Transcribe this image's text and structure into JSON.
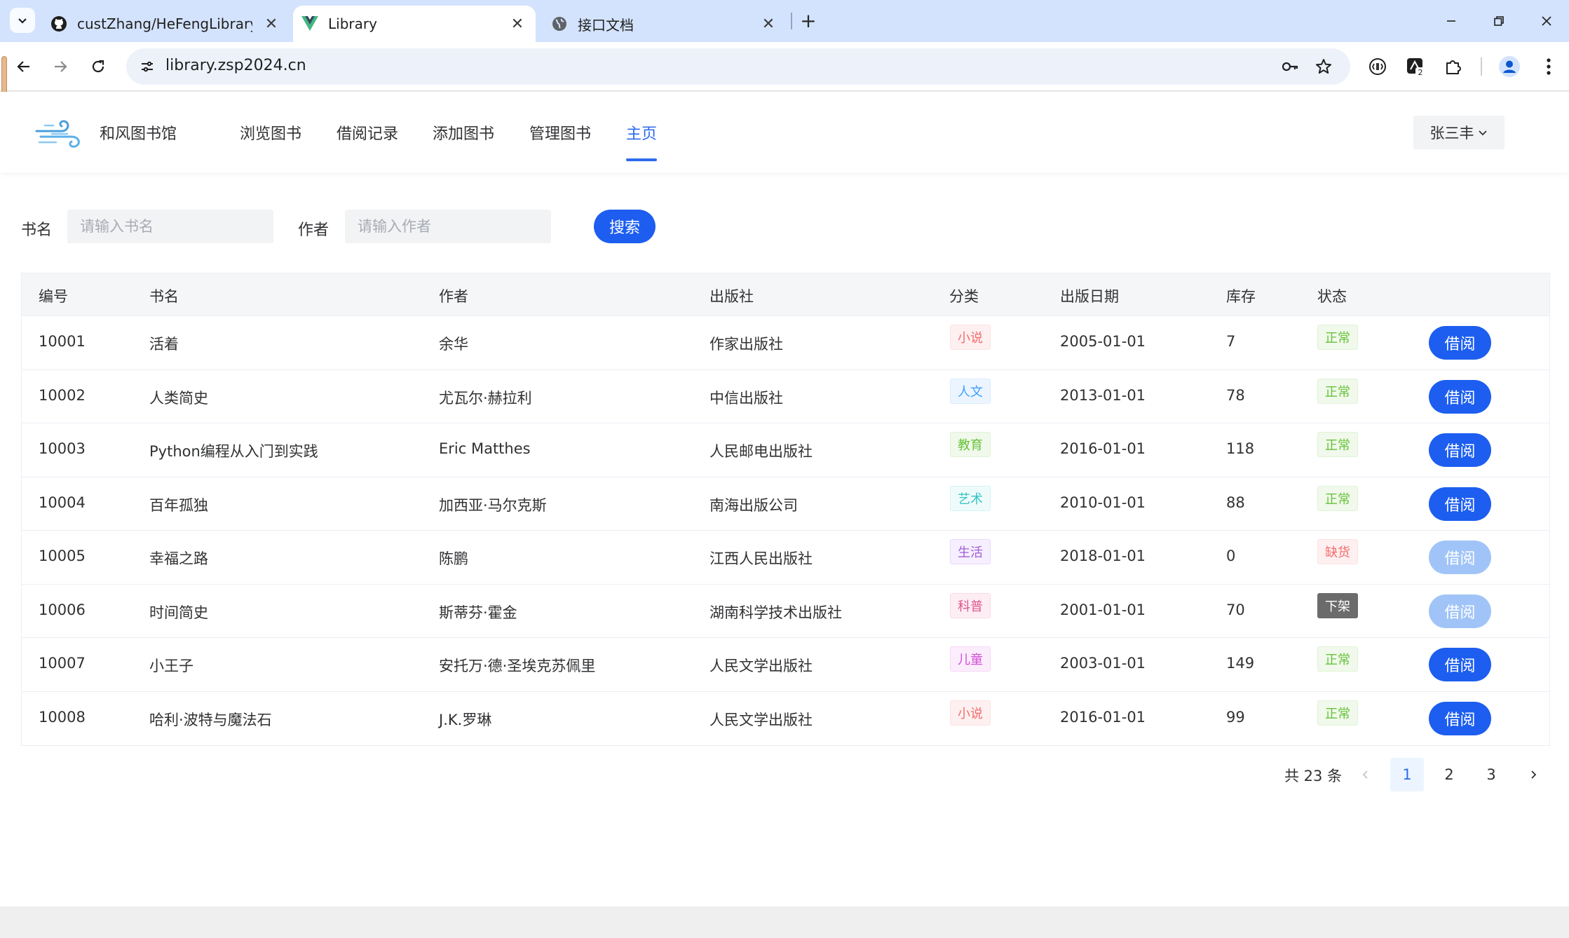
{
  "browser": {
    "tabs": [
      {
        "title": "custZhang/HeFengLibrary-fr",
        "favicon": "github-icon",
        "active": false
      },
      {
        "title": "Library",
        "favicon": "vue-icon",
        "active": true
      },
      {
        "title": "接口文档",
        "favicon": "globe-icon",
        "active": false
      }
    ],
    "url": "library.zsp2024.cn"
  },
  "app": {
    "brand": "和风图书馆",
    "nav": [
      "浏览图书",
      "借阅记录",
      "添加图书",
      "管理图书",
      "主页"
    ],
    "active_nav": "主页",
    "user": "张三丰"
  },
  "search": {
    "title_label": "书名",
    "title_placeholder": "请输入书名",
    "author_label": "作者",
    "author_placeholder": "请输入作者",
    "button": "搜索"
  },
  "table": {
    "headers": [
      "编号",
      "书名",
      "作者",
      "出版社",
      "分类",
      "出版日期",
      "库存",
      "状态"
    ],
    "rows": [
      {
        "id": "10001",
        "title": "活着",
        "author": "余华",
        "publisher": "作家出版社",
        "category": "小说",
        "date": "2005-01-01",
        "stock": "7",
        "status": "正常",
        "action": "借阅",
        "enabled": true
      },
      {
        "id": "10002",
        "title": "人类简史",
        "author": "尤瓦尔·赫拉利",
        "publisher": "中信出版社",
        "category": "人文",
        "date": "2013-01-01",
        "stock": "78",
        "status": "正常",
        "action": "借阅",
        "enabled": true
      },
      {
        "id": "10003",
        "title": "Python编程从入门到实践",
        "author": "Eric Matthes",
        "publisher": "人民邮电出版社",
        "category": "教育",
        "date": "2016-01-01",
        "stock": "118",
        "status": "正常",
        "action": "借阅",
        "enabled": true
      },
      {
        "id": "10004",
        "title": "百年孤独",
        "author": "加西亚·马尔克斯",
        "publisher": "南海出版公司",
        "category": "艺术",
        "date": "2010-01-01",
        "stock": "88",
        "status": "正常",
        "action": "借阅",
        "enabled": true
      },
      {
        "id": "10005",
        "title": "幸福之路",
        "author": "陈鹏",
        "publisher": "江西人民出版社",
        "category": "生活",
        "date": "2018-01-01",
        "stock": "0",
        "status": "缺货",
        "action": "借阅",
        "enabled": false
      },
      {
        "id": "10006",
        "title": "时间简史",
        "author": "斯蒂芬·霍金",
        "publisher": "湖南科学技术出版社",
        "category": "科普",
        "date": "2001-01-01",
        "stock": "70",
        "status": "下架",
        "action": "借阅",
        "enabled": false
      },
      {
        "id": "10007",
        "title": "小王子",
        "author": "安托万·德·圣埃克苏佩里",
        "publisher": "人民文学出版社",
        "category": "儿童",
        "date": "2003-01-01",
        "stock": "149",
        "status": "正常",
        "action": "借阅",
        "enabled": true
      },
      {
        "id": "10008",
        "title": "哈利·波特与魔法石",
        "author": "J.K.罗琳",
        "publisher": "人民文学出版社",
        "category": "小说",
        "date": "2016-01-01",
        "stock": "99",
        "status": "正常",
        "action": "借阅",
        "enabled": true
      }
    ]
  },
  "category_colors": {
    "小说": {
      "fg": "#f56c6c",
      "bg": "#fef0f0",
      "bd": "#fde2e2"
    },
    "人文": {
      "fg": "#409eff",
      "bg": "#ecf5ff",
      "bd": "#d9ecff"
    },
    "教育": {
      "fg": "#67c23a",
      "bg": "#f0f9eb",
      "bd": "#e1f3d8"
    },
    "艺术": {
      "fg": "#35c4c4",
      "bg": "#effbfb",
      "bd": "#d5f3f3"
    },
    "生活": {
      "fg": "#a25fd6",
      "bg": "#f6efff",
      "bd": "#ead9fb"
    },
    "科普": {
      "fg": "#e0548e",
      "bg": "#fdeef4",
      "bd": "#fbd9e6"
    },
    "儿童": {
      "fg": "#d04fd6",
      "bg": "#fcedfd",
      "bd": "#f7d6f9"
    }
  },
  "status_colors": {
    "正常": {
      "fg": "#67c23a",
      "bg": "#f0f9eb",
      "bd": "#e1f3d8"
    },
    "缺货": {
      "fg": "#f56c6c",
      "bg": "#fef0f0",
      "bd": "#fde2e2"
    },
    "下架": {
      "fg": "#ffffff",
      "bg": "#6b6b6b",
      "bd": "#6b6b6b"
    }
  },
  "button_colors": {
    "enabled": "#1d5ef0",
    "disabled": "#a0c4f7"
  },
  "pagination": {
    "total_text": "共 23 条",
    "pages": [
      "1",
      "2",
      "3"
    ],
    "current": "1"
  }
}
